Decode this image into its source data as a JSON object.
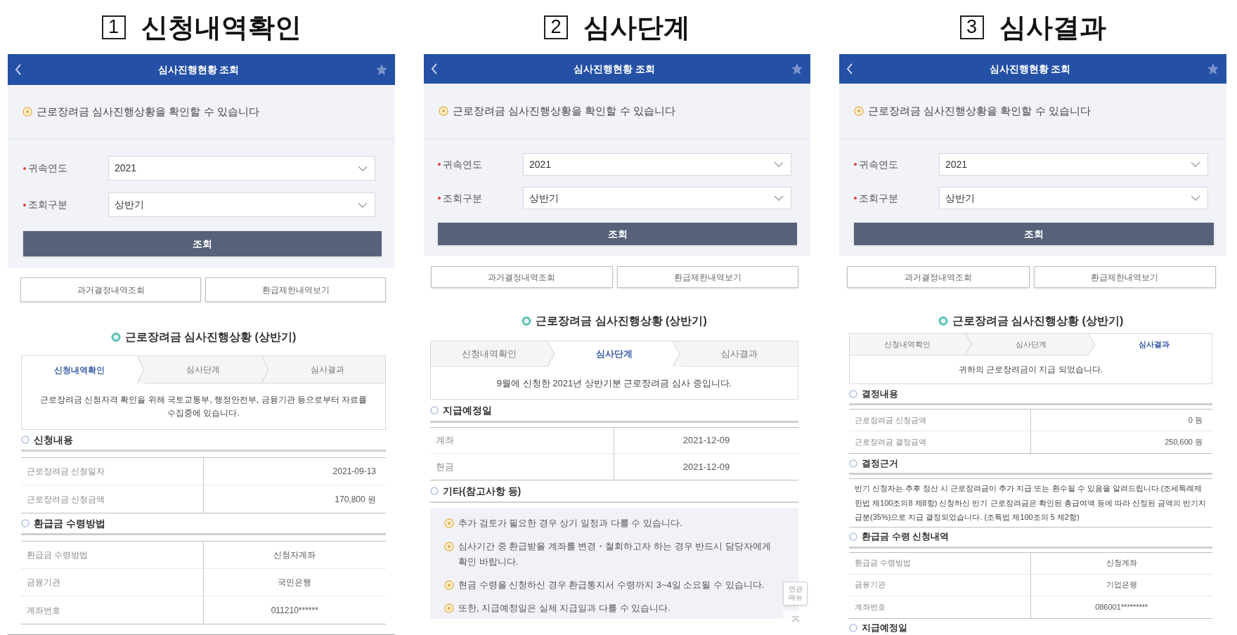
{
  "panels": [
    {
      "step_number": "1",
      "step_title": "신청내역확인",
      "app_bar": {
        "title": "심사진행현황 조회"
      },
      "notice": "근로장려금 심사진행상황을 확인할 수 있습니다",
      "form": {
        "fields": [
          {
            "label": "귀속연도",
            "value": "2021",
            "required": true
          },
          {
            "label": "조회구분",
            "value": "상반기",
            "required": true
          }
        ],
        "submit": "조회"
      },
      "links": [
        "과거결정내역조회",
        "환급제한내역보기"
      ],
      "status_title": "근로장려금 심사진행상황 (상반기)",
      "tabs": [
        {
          "label": "신청내역확인",
          "selected": true
        },
        {
          "label": "심사단계",
          "selected": false
        },
        {
          "label": "심사결과",
          "selected": false
        }
      ],
      "status_message": "근로장려금 신청자격 확인을 위해 국토교통부, 행정안전부, 금융기관 등으로부터 자료를 수집중에 있습니다.",
      "sections": [
        {
          "heading": "신청내용",
          "kind": "summary",
          "rows": [
            {
              "label": "근로장려금 신청일자",
              "value": "2021-09-13"
            },
            {
              "label": "근로장려금 신청금액",
              "value": "170,800 원"
            }
          ]
        },
        {
          "heading": "환급금 수령방법",
          "kind": "details",
          "rows": [
            {
              "label": "환급금 수령방법",
              "value": "신청자계좌"
            },
            {
              "label": "금융기관",
              "value": "국민은행"
            },
            {
              "label": "계좌번호",
              "value": "011210******"
            }
          ]
        }
      ]
    },
    {
      "step_number": "2",
      "step_title": "심사단계",
      "app_bar": {
        "title": "심사진행현황 조회"
      },
      "notice": "근로장려금 심사진행상황을 확인할 수 있습니다",
      "form": {
        "fields": [
          {
            "label": "귀속연도",
            "value": "2021",
            "required": true
          },
          {
            "label": "조회구분",
            "value": "상반기",
            "required": true
          }
        ],
        "submit": "조회"
      },
      "links": [
        "과거결정내역조회",
        "환급제한내역보기"
      ],
      "status_title": "근로장려금 심사진행상황 (상반기)",
      "tabs": [
        {
          "label": "신청내역확인",
          "selected": false
        },
        {
          "label": "심사단계",
          "selected": true
        },
        {
          "label": "심사결과",
          "selected": false
        }
      ],
      "status_message": "9월에 신청한 2021년 상반기분 근로장려금 심사 중입니다.",
      "sections": [
        {
          "heading": "지급예정일",
          "kind": "details",
          "rows": [
            {
              "label": "계좌",
              "value": "2021-12-09"
            },
            {
              "label": "현금",
              "value": "2021-12-09"
            }
          ]
        },
        {
          "heading": "기타(참고사항 등)",
          "kind": "notes",
          "items": [
            "추가 검토가 필요한 경우 상기 일정과 다를 수 있습니다.",
            "심사기간 중 환급받을 계좌를 변경・철회하고자 하는 경우 반드시 담당자에게 확인 바랍니다.",
            "현금 수령을 신청하신 경우 환급통지서 수령까지 3~4일 소요될 수 있습니다.",
            "또한, 지급예정일은 실제 지급일과 다를 수 있습니다."
          ]
        }
      ],
      "quick_menu": {
        "label": "연관 메뉴"
      }
    },
    {
      "step_number": "3",
      "step_title": "심사결과",
      "app_bar": {
        "title": "심사진행현황 조회"
      },
      "notice": "근로장려금 심사진행상황을 확인할 수 있습니다",
      "form": {
        "fields": [
          {
            "label": "귀속연도",
            "value": "2021",
            "required": true
          },
          {
            "label": "조회구분",
            "value": "상반기",
            "required": true
          }
        ],
        "submit": "조회"
      },
      "links": [
        "과거결정내역조회",
        "환급제한내역보기"
      ],
      "status_title": "근로장려금 심사진행상황 (상반기)",
      "tabs": [
        {
          "label": "신청내역확인",
          "selected": false
        },
        {
          "label": "심사단계",
          "selected": false
        },
        {
          "label": "심사결과",
          "selected": true
        }
      ],
      "status_message": "귀하의 근로장려금이 지급 되었습니다.",
      "sections": [
        {
          "heading": "결정내용",
          "kind": "summary",
          "rows": [
            {
              "label": "근로장려금 신청금액",
              "value": "0 원"
            },
            {
              "label": "근로장려금 결정금액",
              "value": "250,600 원"
            }
          ]
        },
        {
          "heading": "결정근거",
          "kind": "paragraph",
          "text": "반기 신청자는 추후 정산 시 근로장려금이 추가 지급 또는 환수될 수 있음을 알려드립니다.(조세특례제한법 제100조의8 제8항) 신청하신 반기 근로장려금은 확인된 총급여액 등에 따라 산정된 금액의 반기지급분(35%)으로 지급 결정되었습니다. (조특법 제100조의 5 제2항)"
        },
        {
          "heading": "환급금 수령 신청내역",
          "kind": "details",
          "rows": [
            {
              "label": "환급금 수령방법",
              "value": "신청계좌"
            },
            {
              "label": "금융기관",
              "value": "기업은행"
            },
            {
              "label": "계좌번호",
              "value": "086001*********"
            }
          ]
        },
        {
          "heading": "지급예정일",
          "kind": "bare"
        }
      ]
    }
  ]
}
